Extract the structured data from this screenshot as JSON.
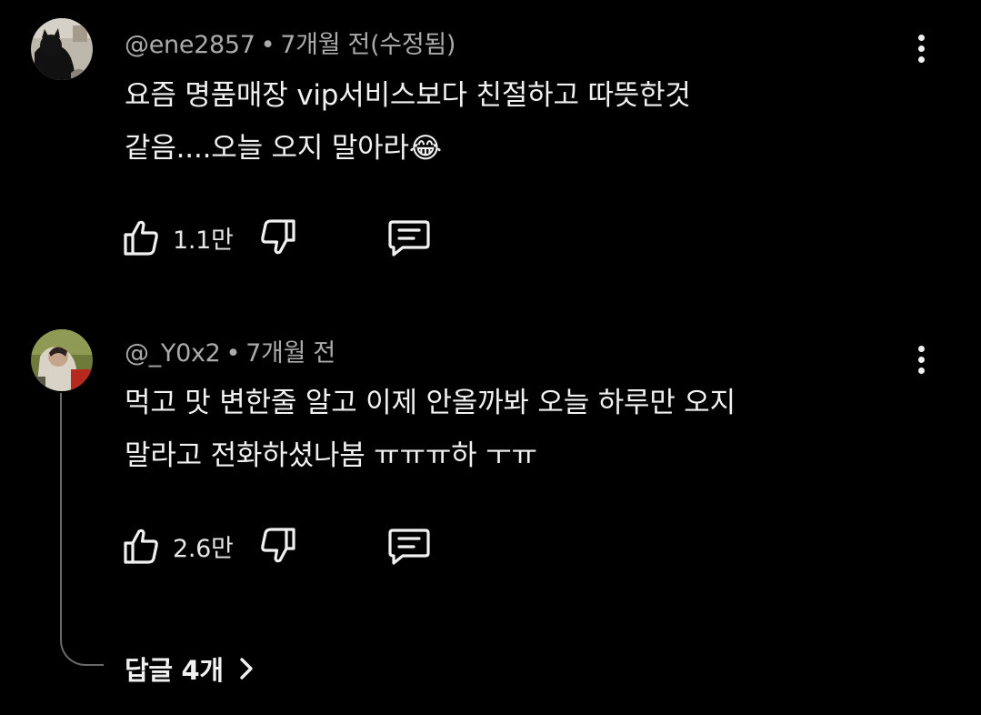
{
  "comments": [
    {
      "handle": "@ene2857",
      "time": "7개월 전(수정됨)",
      "text_line1": "요즘 명품매장 vip서비스보다 친절하고 따뜻한것",
      "text_line2": "같음....오늘 오지 말아라",
      "emoji": "😂",
      "likes": "1.1만"
    },
    {
      "handle": "@_Y0x2",
      "time": "7개월 전",
      "text_line1": "먹고 맛 변한줄 알고 이제 안올까봐 오늘 하루만 오지",
      "text_line2": "말라고 전화하셨나봄 ㅠㅠㅠ하 ㅜㅠ",
      "likes": "2.6만"
    }
  ],
  "separator": "•",
  "replies": {
    "label": "답글 4개"
  },
  "icons": {
    "like": "thumbs-up-icon",
    "dislike": "thumbs-down-icon",
    "reply": "comment-icon",
    "more": "more-vertical-icon",
    "expand": "chevron-right-icon"
  }
}
